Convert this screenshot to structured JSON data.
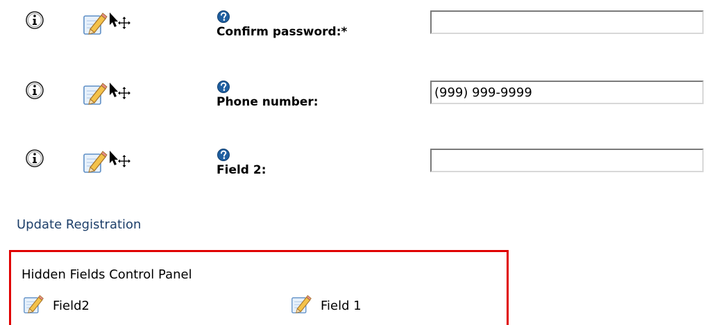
{
  "form": {
    "fields": [
      {
        "label": "Confirm password:*",
        "value": "",
        "placeholder": ""
      },
      {
        "label": "Phone number:",
        "value": "(999) 999-9999",
        "placeholder": ""
      },
      {
        "label": "Field 2:",
        "value": "",
        "placeholder": ""
      }
    ],
    "icons": {
      "info": "info-icon",
      "edit": "edit-icon",
      "move": "move-icon",
      "help": "help-icon"
    }
  },
  "actions": {
    "update_link": "Update Registration"
  },
  "hidden_panel": {
    "title": "Hidden Fields Control Panel",
    "items": [
      {
        "label": "Field2"
      },
      {
        "label": "Field 1"
      }
    ],
    "border_color": "#e00000"
  }
}
